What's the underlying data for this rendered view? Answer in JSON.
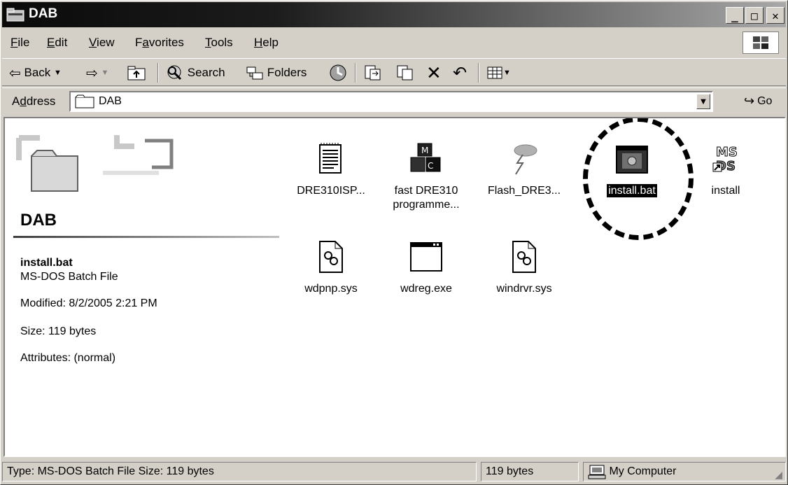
{
  "window": {
    "title": "DAB"
  },
  "menu": [
    {
      "pre": "",
      "ul": "F",
      "post": "ile"
    },
    {
      "pre": "",
      "ul": "E",
      "post": "dit"
    },
    {
      "pre": "",
      "ul": "V",
      "post": "iew"
    },
    {
      "pre": "F",
      "ul": "a",
      "post": "vorites"
    },
    {
      "pre": "",
      "ul": "T",
      "post": "ools"
    },
    {
      "pre": "",
      "ul": "H",
      "post": "elp"
    }
  ],
  "toolbar": {
    "back": "Back",
    "search": "Search",
    "folders": "Folders"
  },
  "address": {
    "label_pre": "A",
    "label_ul": "d",
    "label_post": "dress",
    "value": "DAB",
    "go": "Go"
  },
  "sidebar": {
    "folder_name": "DAB",
    "selected_name": "install.bat",
    "selected_type": "MS-DOS Batch File",
    "modified": "Modified: 8/2/2005 2:21 PM",
    "size": "Size: 119 bytes",
    "attributes": "Attributes: (normal)"
  },
  "files": [
    {
      "name": "DRE310ISP...",
      "icon": "notepad-file-icon"
    },
    {
      "name": "fast DRE310 programme...",
      "icon": "blocks-file-icon"
    },
    {
      "name": "Flash_DRE3...",
      "icon": "storm-file-icon"
    },
    {
      "name": "install.bat",
      "icon": "batch-file-icon"
    },
    {
      "name": "install",
      "icon": "msdos-shortcut-icon"
    },
    {
      "name": "wdpnp.sys",
      "icon": "system-file-icon"
    },
    {
      "name": "wdreg.exe",
      "icon": "application-icon"
    },
    {
      "name": "windrvr.sys",
      "icon": "system-file-icon"
    }
  ],
  "status": {
    "type": "Type: MS-DOS Batch File Size: 119 bytes",
    "size": "119 bytes",
    "zone": "My Computer"
  }
}
